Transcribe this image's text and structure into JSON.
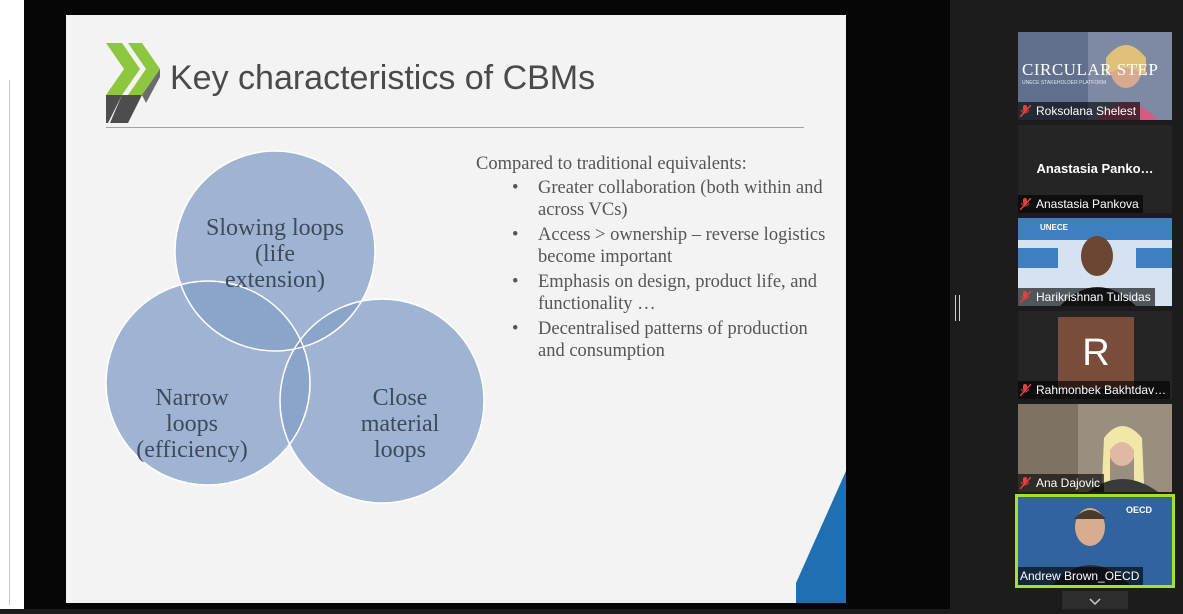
{
  "slide": {
    "title": "Key characteristics of CBMs",
    "venn": {
      "top": [
        "Slowing loops",
        "(life",
        "extension)"
      ],
      "left": [
        "Narrow",
        "loops",
        "(efficiency)"
      ],
      "right": [
        "Close",
        "material",
        "loops"
      ]
    },
    "intro": "Compared to traditional equivalents:",
    "bullets": [
      "Greater collaboration (both within and across VCs)",
      "Access > ownership – reverse logistics become important",
      "Emphasis on design, product life, and functionality …",
      "Decentralised patterns of production and consumption"
    ],
    "colors": {
      "circle": "#9fb4d3",
      "overlap": "#7a93bf",
      "title": "#4a4a4a",
      "logo_green": "#8dc63f"
    }
  },
  "participants": [
    {
      "name": "Roksolana Shelest",
      "video_text": "CIRCULAR STEP",
      "video_subtext": "UNECE STAKEHOLDER PLATFORM"
    },
    {
      "name": "Anastasia Pankova",
      "display_name": "Anastasia  Panko…"
    },
    {
      "name": "Harikrishnan Tulsidas",
      "banner": "UNECE"
    },
    {
      "name": "Rahmonbek Bakhtdav…",
      "avatar_letter": "R"
    },
    {
      "name": "Ana Dajovic"
    },
    {
      "name": "Andrew Brown_OECD",
      "banner": "OECD"
    }
  ],
  "icons": {
    "muted_mic": "mic-muted-icon",
    "scroll_down": "chevron-down-icon"
  }
}
